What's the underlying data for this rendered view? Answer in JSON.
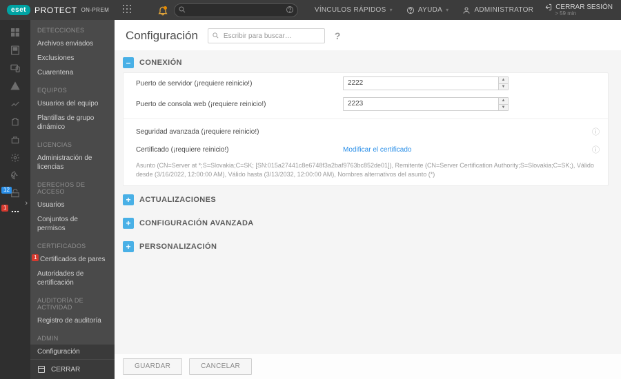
{
  "brand": {
    "badge": "eset",
    "product": "PROTECT",
    "variant": "ON-PREM"
  },
  "top": {
    "search_placeholder": "",
    "quick_links": "VÍNCULOS RÁPIDOS",
    "help": "AYUDA",
    "user": "ADMINISTRATOR",
    "logout": "CERRAR SESIÓN",
    "logout_sub": "> 59 min"
  },
  "rail": {
    "badge_blue": "12",
    "badge_red": "1"
  },
  "side": {
    "g1_head": "DETECCIONES",
    "g1_a": "Archivos enviados",
    "g1_b": "Exclusiones",
    "g1_c": "Cuarentena",
    "g2_head": "EQUIPOS",
    "g2_a": "Usuarios del equipo",
    "g2_b": "Plantillas de grupo dinámico",
    "g3_head": "LICENCIAS",
    "g3_a": "Administración de licencias",
    "g4_head": "DERECHOS DE ACCESO",
    "g4_a": "Usuarios",
    "g4_b": "Conjuntos de permisos",
    "g5_head": "CERTIFICADOS",
    "g5_a": "Certificados de pares",
    "g5_a_badge": "1",
    "g5_b": "Autoridades de certificación",
    "g6_head": "AUDITORÍA DE ACTIVIDAD",
    "g6_a": "Registro de auditoría",
    "g7_head": "ADMIN",
    "g7_a": "Configuración",
    "footer": "CERRAR"
  },
  "page": {
    "title": "Configuración",
    "search_placeholder": "Escribir para buscar…"
  },
  "sections": {
    "connection": "CONEXIÓN",
    "updates": "ACTUALIZACIONES",
    "advanced": "CONFIGURACIÓN AVANZADA",
    "custom": "PERSONALIZACIÓN"
  },
  "conn": {
    "server_port_label": "Puerto de servidor (¡requiere reinicio!)",
    "server_port_value": "2222",
    "console_port_label": "Puerto de consola web (¡requiere reinicio!)",
    "console_port_value": "2223",
    "adv_sec_label": "Seguridad avanzada (¡requiere reinicio!)",
    "cert_label": "Certificado (¡requiere reinicio!)",
    "cert_link": "Modificar el certificado",
    "cert_note": "Asunto (CN=Server at *;S=Slovakia;C=SK; [SN:015a27441c8e6748f3a2baf9763bc852de01]), Remitente (CN=Server Certification Authority;S=Slovakia;C=SK;), Válido desde (3/16/2022, 12:00:00 AM), Válido hasta (3/13/2032, 12:00:00 AM), Nombres alternativos del asunto (*)"
  },
  "buttons": {
    "save": "GUARDAR",
    "cancel": "CANCELAR"
  }
}
